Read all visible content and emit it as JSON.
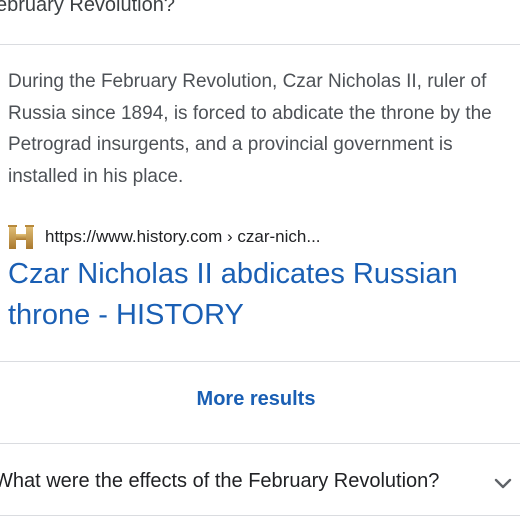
{
  "top_question": {
    "text": "ebruary Revolution?"
  },
  "answer": {
    "snippet": "During the February Revolution, Czar Nicholas II, ruler of Russia since 1894, is forced to abdicate the throne by the Petrograd insurgents, and a provincial government is installed in his place.",
    "source_url": "https://www.history.com › czar-nich...",
    "favicon_icon": "history-h-icon",
    "result_title": "Czar Nicholas II abdicates Russian throne - HISTORY"
  },
  "more_results_label": "More results",
  "related_question": {
    "text": "What were the effects of the February Revolution?",
    "icon": "chevron-down-icon"
  },
  "colors": {
    "link": "#1a5fb4",
    "snippet_text": "#4d5156",
    "divider": "#dadce0",
    "favicon": "#c8a15a"
  }
}
